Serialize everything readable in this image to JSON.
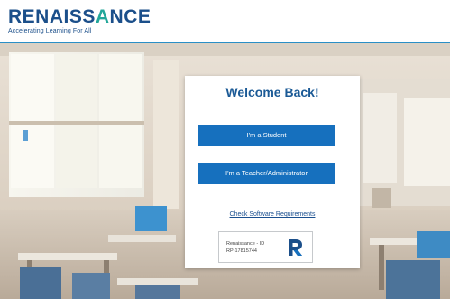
{
  "brand": {
    "name_dark": "RENAISS",
    "name_green": "A",
    "name_dark_end": "NCE",
    "tagline": "Accelerating Learning For All",
    "color_dark": "#1b4f8a",
    "color_green": "#23a79a"
  },
  "login": {
    "title": "Welcome Back!",
    "student_button": "I'm a Student",
    "teacher_button": "I'm a Teacher/Administrator",
    "requirements_link": "Check Software Requirements",
    "badge_line1": "Renaissance - ID",
    "badge_line2": "RP-17815744",
    "badge_icon": "renaissance-r-logo-icon",
    "accent_color": "#1670be"
  },
  "background": {
    "scene": "classroom-photo"
  }
}
